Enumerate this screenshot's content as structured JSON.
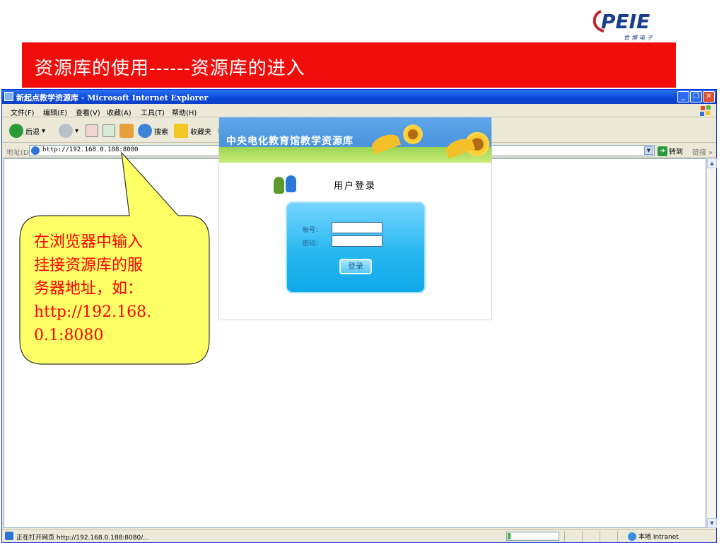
{
  "slide": {
    "logo_text": "PEIE",
    "logo_sub": "世博电子",
    "title": "资源库的使用------资源库的进入",
    "callout": "在浏览器中输入\n挂接资源库的服\n务器地址，如：\nhttp://192.168.\n0.1:8080"
  },
  "window": {
    "title": "新起点教学资源库 - Microsoft Internet Explorer",
    "menu": [
      "文件(F)",
      "编辑(E)",
      "查看(V)",
      "收藏(A)",
      "工具(T)",
      "帮助(H)"
    ],
    "toolbar": {
      "back": "后退",
      "search": "搜索",
      "favorites": "收藏夹"
    },
    "address_label": "地址(D)",
    "url": "http://192.168.0.188:8080",
    "go_label": "转到",
    "links_label": "链接 »",
    "status_text": "正在打开网页 http://192.168.0.188:8080/...",
    "zone_text": "本地 Intranet",
    "progress": 0.05
  },
  "page": {
    "banner_title": "中央电化教育馆教学资源库",
    "login_heading": "用户登录",
    "username_label": "帐号：",
    "password_label": "密码：",
    "username_value": "",
    "password_value": "",
    "login_button": "登录"
  },
  "colors": {
    "slide_title_bg": "#f20d0d",
    "callout_fill": "#ffff66",
    "callout_text": "#ff0000",
    "xp_title_blue": "#0a46d9",
    "login_box": "#28b8f0"
  }
}
